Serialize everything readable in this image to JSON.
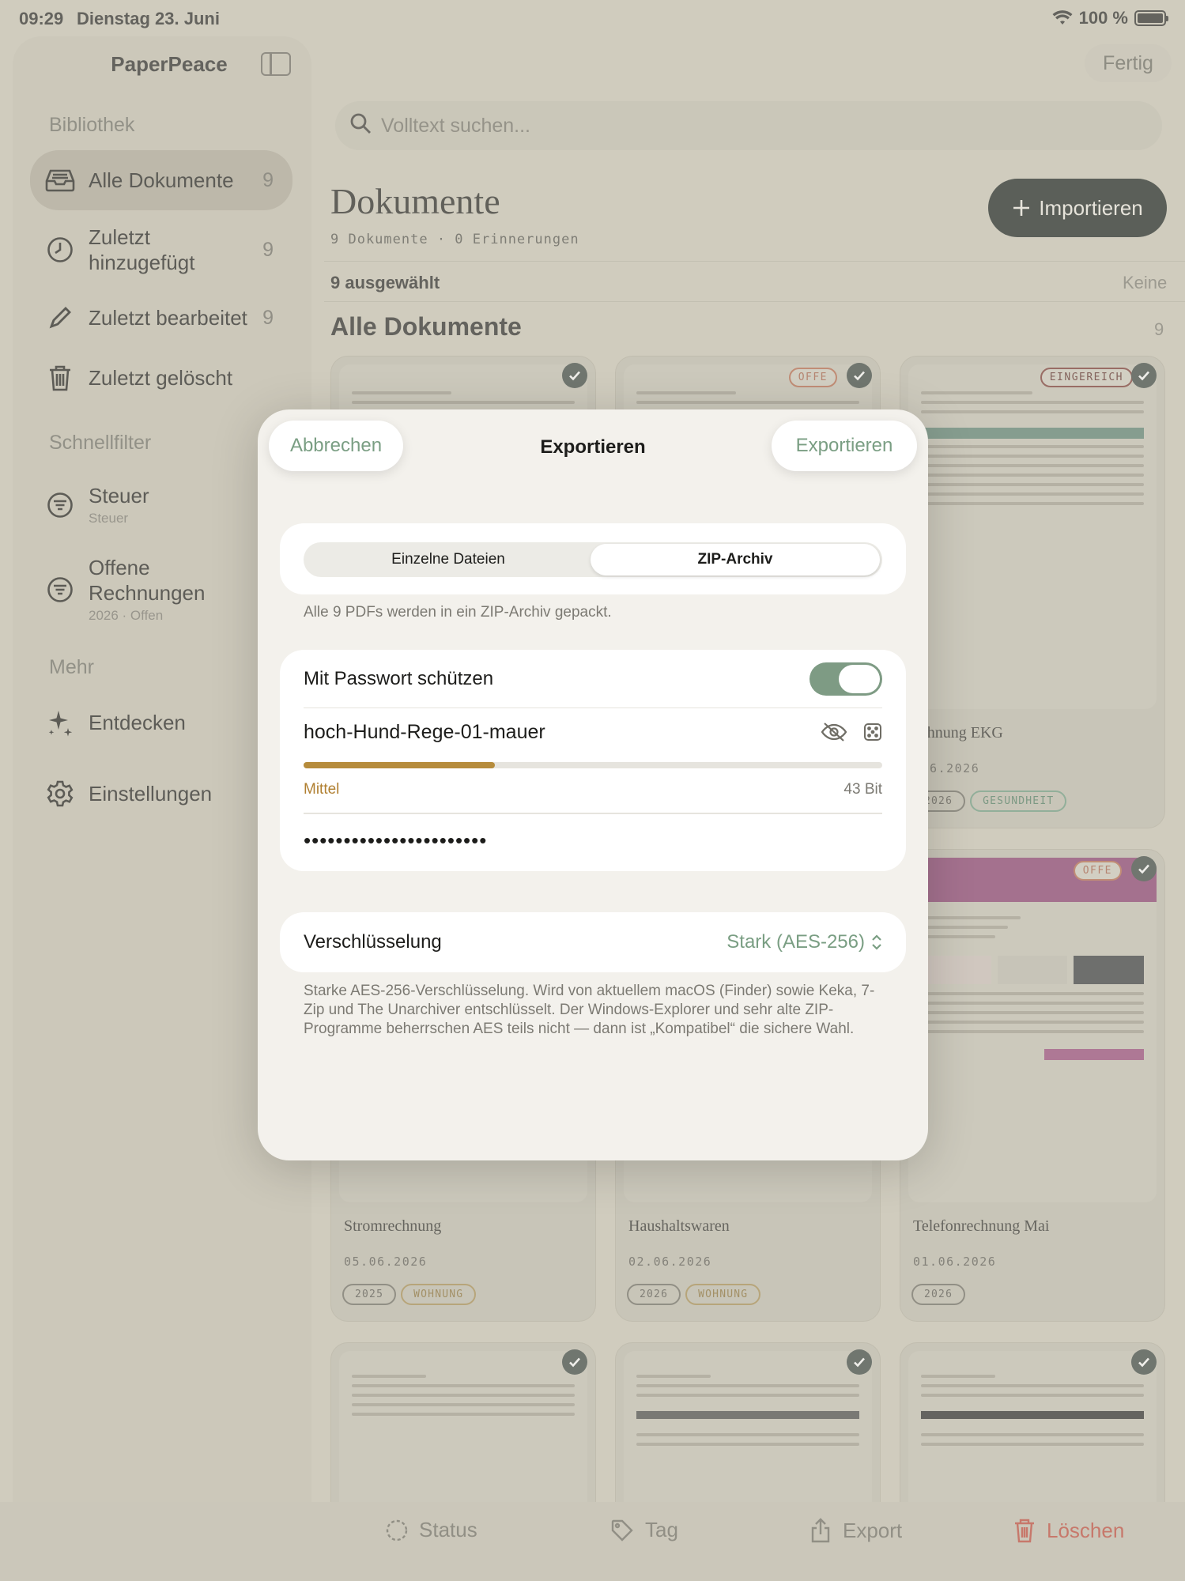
{
  "statusbar": {
    "time": "09:29",
    "date": "Dienstag 23. Juni",
    "battery": "100 %"
  },
  "sidebar": {
    "app_title": "PaperPeace",
    "sections": {
      "library": "Bibliothek",
      "quickfilter": "Schnellfilter",
      "more": "Mehr"
    },
    "library_items": [
      {
        "label": "Alle Dokumente",
        "count": "9",
        "icon": "tray-icon"
      },
      {
        "label": "Zuletzt hinzugefügt",
        "count": "9",
        "icon": "clock-icon"
      },
      {
        "label": "Zuletzt bearbeitet",
        "count": "9",
        "icon": "pencil-icon"
      },
      {
        "label": "Zuletzt gelöscht",
        "icon": "trash-icon"
      }
    ],
    "filters": [
      {
        "label": "Steuer",
        "sub": "Steuer",
        "icon": "filter-icon"
      },
      {
        "label": "Offene Rechnungen",
        "sub": "2026 · Offen",
        "icon": "filter-icon"
      }
    ],
    "more_items": [
      {
        "label": "Entdecken",
        "icon": "sparkle-icon"
      },
      {
        "label": "Einstellungen",
        "icon": "gear-icon"
      }
    ]
  },
  "header": {
    "done": "Fertig",
    "search_placeholder": "Volltext suchen...",
    "title": "Dokumente",
    "subtitle": "9 Dokumente · 0 Erinnerungen",
    "import": "Importieren",
    "selected": "9 ausgewählt",
    "none": "Keine",
    "section": "Alle Dokumente",
    "section_count": "9"
  },
  "cards": [
    {
      "title": "",
      "date": "",
      "tags": []
    },
    {
      "title": "",
      "date": "",
      "tags": [],
      "badge": "OFFE"
    },
    {
      "title": "echnung EKG",
      "date": ".06.2026",
      "tags": [
        "2026",
        "GESUNDHEIT"
      ],
      "badge": "EINGEREICH"
    },
    {
      "title": "Stromrechnung",
      "date": "05.06.2026",
      "tags": [
        "2025",
        "WOHNUNG"
      ]
    },
    {
      "title": "Haushaltswaren",
      "date": "02.06.2026",
      "tags": [
        "2026",
        "WOHNUNG"
      ]
    },
    {
      "title": "Telefonrechnung Mai",
      "date": "01.06.2026",
      "tags": [
        "2026"
      ],
      "badge": "OFFE"
    }
  ],
  "toolbar": {
    "status": "Status",
    "tag": "Tag",
    "export": "Export",
    "delete": "Löschen"
  },
  "modal": {
    "cancel": "Abbrechen",
    "title": "Exportieren",
    "confirm": "Exportieren",
    "segments": [
      "Einzelne Dateien",
      "ZIP-Archiv"
    ],
    "selected_segment": "ZIP-Archiv",
    "segment_caption": "Alle 9 PDFs werden in ein ZIP-Archiv gepackt.",
    "password_toggle_label": "Mit Passwort schützen",
    "password_toggle_on": true,
    "password": "hoch-Hund-Rege-01-mauer",
    "strength_label": "Mittel",
    "strength_fraction": 0.33,
    "strength_bits": "43 Bit",
    "password_masked": "•••••••••••••••••••••••",
    "encryption_label": "Verschlüsselung",
    "encryption_value": "Stark (AES-256)",
    "encryption_desc": "Starke AES-256-Verschlüsselung. Wird von aktuellem macOS (Finder) sowie Keka, 7-Zip und The Unarchiver entschlüsselt. Der Windows-Explorer und sehr alte ZIP-Programme beherrschen AES teils nicht — dann ist „Kompatibel“ die sichere Wahl."
  },
  "colors": {
    "accent": "#7a9e83",
    "strength": "#b68c3c",
    "delete": "#c24a3c",
    "import_bg": "#1c2421"
  }
}
